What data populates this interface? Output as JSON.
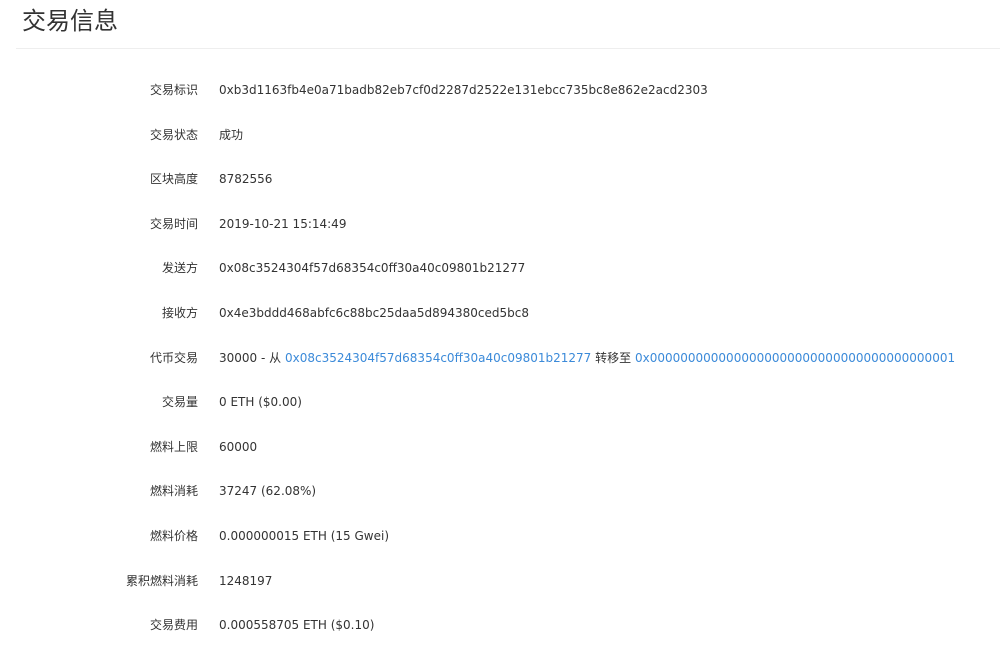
{
  "header": {
    "title": "交易信息"
  },
  "colors": {
    "link": "#3b8ad9",
    "success": "#2bb24c",
    "text": "#333333"
  },
  "details": {
    "tx_hash": {
      "label": "交易标识",
      "value": "0xb3d1163fb4e0a71badb82eb7cf0d2287d2522e131ebcc735bc8e862e2acd2303"
    },
    "status": {
      "label": "交易状态",
      "value": "成功"
    },
    "block_height": {
      "label": "区块高度",
      "value": "8782556"
    },
    "tx_time": {
      "label": "交易时间",
      "value": "2019-10-21 15:14:49"
    },
    "sender": {
      "label": "发送方",
      "value": "0x08c3524304f57d68354c0ff30a40c09801b21277"
    },
    "receiver": {
      "label": "接收方",
      "value": "0x4e3bddd468abfc6c88bc25daa5d894380ced5bc8"
    },
    "token_transfer": {
      "label": "代币交易",
      "amount": "30000",
      "from_text": "- 从",
      "from_address": "0x08c3524304f57d68354c0ff30a40c09801b21277",
      "to_text": "转移至",
      "to_address": "0x0000000000000000000000000000000000000001"
    },
    "amount": {
      "label": "交易量",
      "value": "0 ETH ($0.00)"
    },
    "gas_limit": {
      "label": "燃料上限",
      "value": "60000"
    },
    "gas_used": {
      "label": "燃料消耗",
      "value": "37247 (62.08%)"
    },
    "gas_price": {
      "label": "燃料价格",
      "value": "0.000000015 ETH (15 Gwei)"
    },
    "cumulative_gas": {
      "label": "累积燃料消耗",
      "value": "1248197"
    },
    "fee": {
      "label": "交易费用",
      "value": "0.000558705 ETH ($0.10)"
    }
  }
}
